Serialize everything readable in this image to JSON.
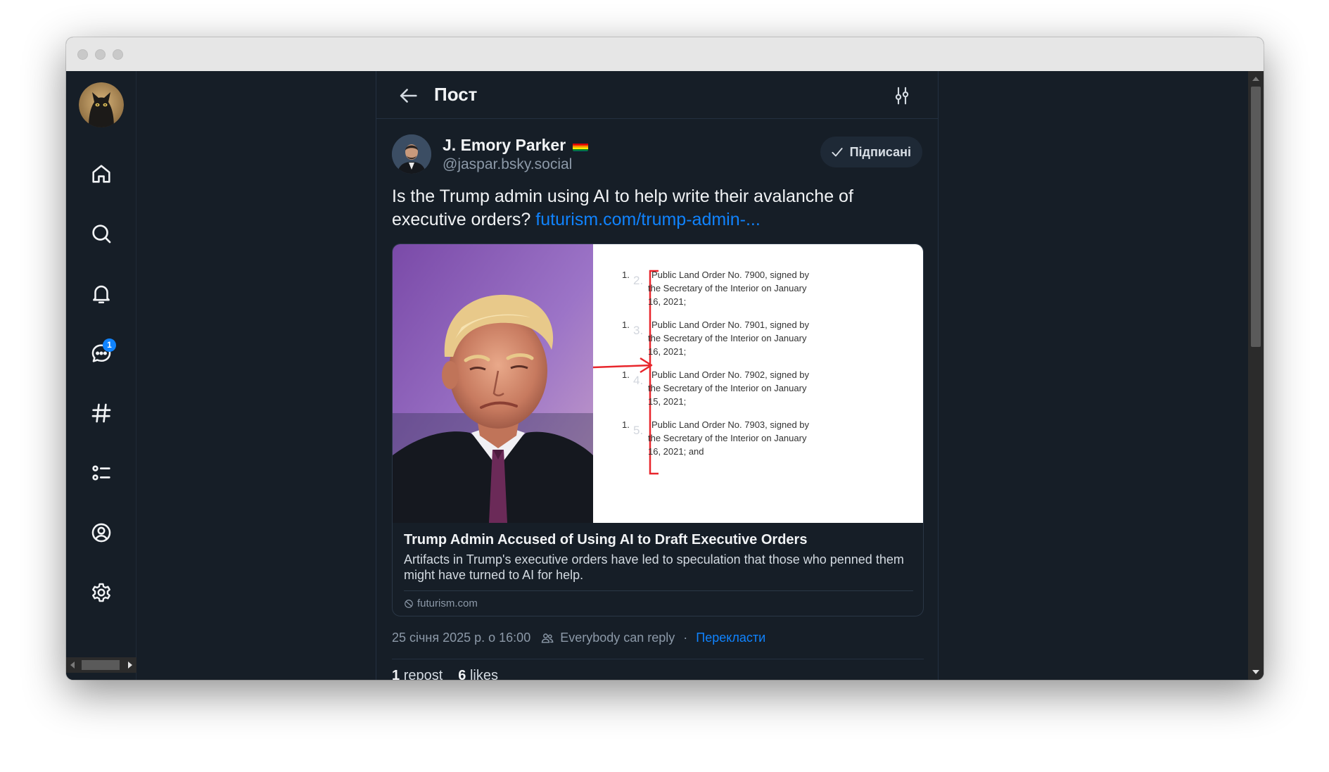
{
  "header": {
    "title": "Пост"
  },
  "sidebar": {
    "items": [
      {
        "icon": "home-icon"
      },
      {
        "icon": "search-icon"
      },
      {
        "icon": "bell-icon"
      },
      {
        "icon": "chat-icon",
        "badge": "1"
      },
      {
        "icon": "hashtag-icon"
      },
      {
        "icon": "list-icon"
      },
      {
        "icon": "profile-icon"
      },
      {
        "icon": "gear-icon"
      }
    ]
  },
  "post": {
    "author_name": "J. Emory Parker",
    "author_handle": "@jaspar.bsky.social",
    "follow_label": "Підписані",
    "text": "Is the Trump admin using AI to help write their avalanche of executive orders?",
    "link_text": "futurism.com/trump-admin-...",
    "timestamp": "25 січня 2025 р. о 16:00",
    "reply_setting": "Everybody can reply",
    "separator": "·",
    "translate_label": "Перекласти",
    "reposts_count": "1",
    "reposts_label": "repost",
    "likes_count": "6",
    "likes_label": "likes"
  },
  "embed": {
    "title": "Trump Admin Accused of Using AI to Draft Executive Orders",
    "description": "Artifacts in Trump's executive orders have led to speculation that those who penned them might have turned to AI for help.",
    "domain": "futurism.com",
    "document_items": [
      {
        "lead": "1.",
        "ghost": "2.",
        "text": [
          "Public Land Order No. 7900, signed by",
          "the Secretary of the Interior on January",
          "16, 2021;"
        ]
      },
      {
        "lead": "1.",
        "ghost": "3.",
        "text": [
          "Public Land Order No. 7901, signed by",
          "the Secretary of the Interior on January",
          "16, 2021;"
        ]
      },
      {
        "lead": "1.",
        "ghost": "4.",
        "text": [
          "Public Land Order No. 7902, signed by",
          "the Secretary of the Interior on January",
          "15, 2021;"
        ]
      },
      {
        "lead": "1.",
        "ghost": "5.",
        "text": [
          "Public Land Order No. 7903, signed by",
          "the Secretary of the Interior on January",
          "16, 2021; and"
        ]
      }
    ]
  },
  "colors": {
    "background": "#161e27",
    "accent": "#1083fe",
    "text": "#f1f3f5",
    "muted": "#8c99a8",
    "annotation_red": "#e8262c"
  }
}
